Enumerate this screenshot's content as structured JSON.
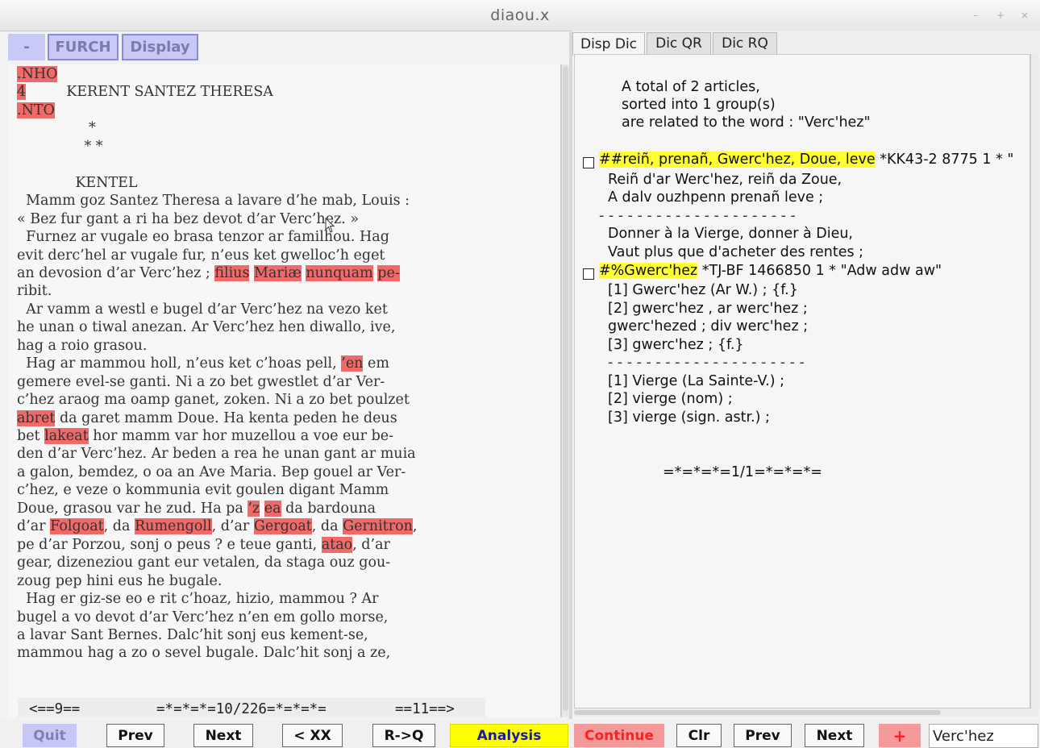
{
  "window": {
    "title": "diaou.x",
    "controls": [
      "–",
      "+",
      "×"
    ]
  },
  "left_toolbar": {
    "minus_label": "-",
    "furch_label": "FURCH",
    "display_label": "Display"
  },
  "text_lines": [
    [
      {
        "t": ".NHO",
        "h": true
      }
    ],
    [
      {
        "t": "4",
        "h": true
      },
      {
        "t": "         KERENT SANTEZ THERESA",
        "h": false
      }
    ],
    [
      {
        "t": ".NTO",
        "h": true
      }
    ],
    [
      {
        "t": "                *",
        "h": false
      }
    ],
    [
      {
        "t": "               * *",
        "h": false
      }
    ],
    [
      {
        "t": "",
        "h": false
      }
    ],
    [
      {
        "t": "             KENTEL",
        "h": false
      }
    ],
    [
      {
        "t": "  Mamm goz Santez Theresa a lavare d’he mab, Louis :",
        "h": false
      }
    ],
    [
      {
        "t": "« Bez fur gant a ri ha bez devot d’ar Verc’hez. »",
        "h": false
      }
    ],
    [
      {
        "t": "  Furnez ar vugale eo brasa tenzor ar familhou. Hag",
        "h": false
      }
    ],
    [
      {
        "t": "evit derc’hel ar vugale fur, n’eus ket gwelloc’h eget",
        "h": false
      }
    ],
    [
      {
        "t": "an devosion d’ar Verc’hez ; ",
        "h": false
      },
      {
        "t": "filius",
        "h": true
      },
      {
        "t": " ",
        "h": false
      },
      {
        "t": "Mariæ",
        "h": true
      },
      {
        "t": " ",
        "h": false
      },
      {
        "t": "nunquam",
        "h": true
      },
      {
        "t": " ",
        "h": false
      },
      {
        "t": "pe-",
        "h": true
      }
    ],
    [
      {
        "t": "ribit.",
        "h": false
      }
    ],
    [
      {
        "t": "  Ar vamm a westl e bugel d’ar Verc’hez na vezo ket",
        "h": false
      }
    ],
    [
      {
        "t": "he unan o tiwal anezan. Ar Verc’hez hen diwallo, ive,",
        "h": false
      }
    ],
    [
      {
        "t": "hag a roio grasou.",
        "h": false
      }
    ],
    [
      {
        "t": "  Hag ar mammou holl, n’eus ket c’hoas pell, ",
        "h": false
      },
      {
        "t": "’en",
        "h": true
      },
      {
        "t": " em",
        "h": false
      }
    ],
    [
      {
        "t": "gemere evel-se ganti. Ni a zo bet gwestlet d’ar Ver-",
        "h": false
      }
    ],
    [
      {
        "t": "c’hez araog ma oamp ganet, zoken. Ni a zo bet poulzet",
        "h": false
      }
    ],
    [
      {
        "t": "abret",
        "h": true
      },
      {
        "t": " da garet mamm Doue. Ha kenta peden he deus",
        "h": false
      }
    ],
    [
      {
        "t": "bet ",
        "h": false
      },
      {
        "t": "lakeat",
        "h": true
      },
      {
        "t": " hor mamm var hor muzellou a voe eur be-",
        "h": false
      }
    ],
    [
      {
        "t": "den d’ar Verc’hez. Ar beden a rea he unan gant ar muia",
        "h": false
      }
    ],
    [
      {
        "t": "a galon, bemdez, o oa an Ave Maria. Bep gouel ar Ver-",
        "h": false
      }
    ],
    [
      {
        "t": "c’hez, e veze o kommunia evit goulen digant Mamm",
        "h": false
      }
    ],
    [
      {
        "t": "Doue, grasou var he zud. Ha pa ",
        "h": false
      },
      {
        "t": "’z",
        "h": true
      },
      {
        "t": " ",
        "h": false
      },
      {
        "t": "ea",
        "h": true
      },
      {
        "t": " da bardouna",
        "h": false
      }
    ],
    [
      {
        "t": "d’ar ",
        "h": false
      },
      {
        "t": "Folgoat",
        "h": true
      },
      {
        "t": ", da ",
        "h": false
      },
      {
        "t": "Rumengoll",
        "h": true
      },
      {
        "t": ", d’ar ",
        "h": false
      },
      {
        "t": "Gergoat",
        "h": true
      },
      {
        "t": ", da ",
        "h": false
      },
      {
        "t": "Gernitron",
        "h": true
      },
      {
        "t": ",",
        "h": false
      }
    ],
    [
      {
        "t": "pe d’ar Porzou, sonj o peus ? e teue ganti, ",
        "h": false
      },
      {
        "t": "atao",
        "h": true
      },
      {
        "t": ", d’ar",
        "h": false
      }
    ],
    [
      {
        "t": "gear, dizeneziou gant eur vetalen, da staga ouz gou-",
        "h": false
      }
    ],
    [
      {
        "t": "zoug pep hini eus he bugale.",
        "h": false
      }
    ],
    [
      {
        "t": "  Hag er giz-se eo e rit c’hoaz, hizio, mammou ? Ar",
        "h": false
      }
    ],
    [
      {
        "t": "bugel a vo devot d’ar Verc’hez n’en em gollo morse,",
        "h": false
      }
    ],
    [
      {
        "t": "a lavar Sant Bernes. Dalc’hit sonj eus kement-se,",
        "h": false
      }
    ],
    [
      {
        "t": "mammou hag a zo o sevel bugale. Dalc’hit sonj a ze,",
        "h": false
      }
    ]
  ],
  "pager": {
    "prev": "<==9==",
    "current": "=*=*=*=10/226=*=*=*=",
    "next": "==11==>"
  },
  "tabs": [
    "Disp Dic",
    "Dic QR",
    "Dic RQ"
  ],
  "dic": {
    "summary": [
      "A total of 2 articles,",
      "sorted into 1 group(s)",
      "are related to the word : \"Verc'hez\""
    ],
    "entry1": {
      "head_highlight": "##reiñ, prenañ, Gwerc'hez, Doue, leve",
      "head_rest": " *KK43-2 8775 1 * \"",
      "lines": [
        "Reiñ d'ar Werc'hez, reiñ da Zoue,",
        "A dalv ouzhpenn prenañ leve ;",
        "- - - - - - - - - - - - - - - - - - - - -",
        "Donner à la Vierge, donner à Dieu,",
        "Vaut plus que d'acheter des rentes ;"
      ]
    },
    "entry2": {
      "head_highlight": "#%Gwerc'hez",
      "head_rest": " *TJ-BF 1466850  1 * \"Adw adw aw\"",
      "lines": [
        "[1] Gwerc'hez (Ar W.) ; {f.}",
        "[2] gwerc'hez , ar werc'hez ;",
        "gwerc'hezed ; div werc'hez ;",
        "[3] gwerc'hez ; {f.}",
        "- - - - - - - - - - - - - - - - - - - - -",
        "[1] Vierge (La Sainte-V.) ;",
        "[2] vierge (nom) ;",
        "[3] vierge (sign. astr.) ;"
      ]
    },
    "group_counter": "=*=*=*=1/1=*=*=*="
  },
  "bottom": {
    "quit": "Quit",
    "prev": "Prev",
    "next": "Next",
    "xx": "< XX",
    "rq": "R->Q",
    "analysis": "Analysis",
    "continue": "Continue",
    "clr": "Clr",
    "prev2": "Prev",
    "next2": "Next",
    "plus": "+",
    "word_value": "Verc'hez"
  },
  "colors": {
    "highlight_red": "#f06a6a",
    "highlight_yellow": "#ffff33",
    "toolbar_blue": "#c9c9f6"
  }
}
